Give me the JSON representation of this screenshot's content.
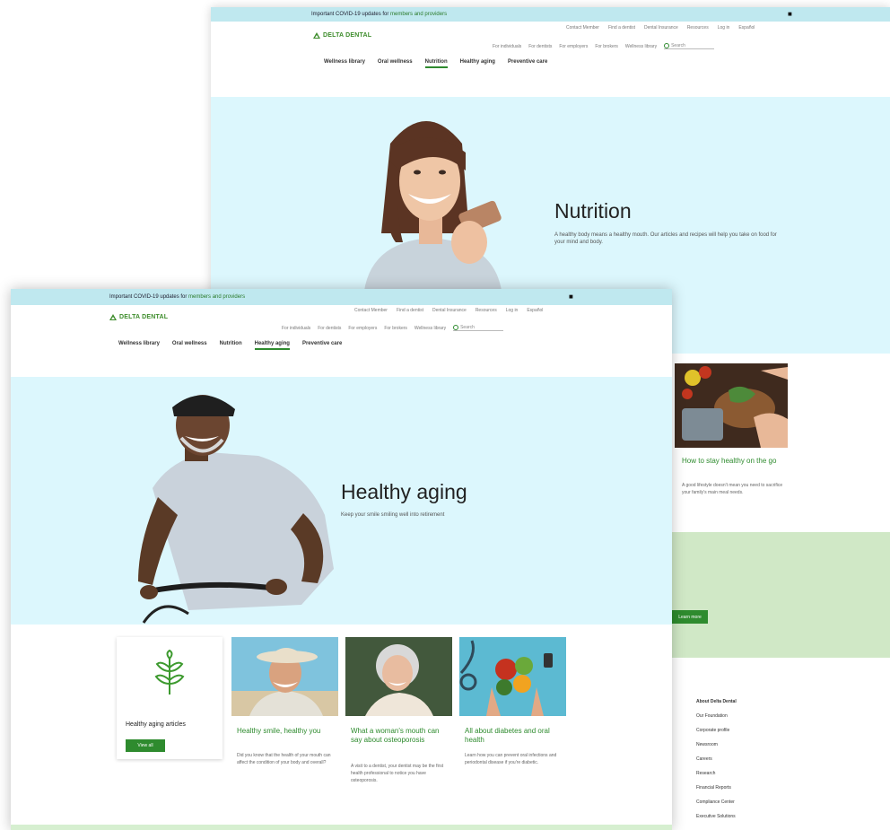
{
  "back": {
    "alert": {
      "text": "Important COVID-19 updates for ",
      "link": "members and providers"
    },
    "logo": "DELTA DENTAL",
    "util_nav": [
      "Contact Member",
      "Find a dentist",
      "Dental Insurance",
      "Resources",
      "Log in",
      "Español"
    ],
    "audience_nav": [
      "For individuals",
      "For dentists",
      "For employers",
      "For brokers",
      "Wellness library"
    ],
    "search_placeholder": "Search",
    "sub_nav": [
      {
        "label": "Wellness library",
        "active": false
      },
      {
        "label": "Oral wellness",
        "active": false
      },
      {
        "label": "Nutrition",
        "active": true
      },
      {
        "label": "Healthy aging",
        "active": false
      },
      {
        "label": "Preventive care",
        "active": false
      }
    ],
    "hero": {
      "title": "Nutrition",
      "desc": "A healthy body means a healthy mouth. Our articles and recipes will help you take on food for your mind and body."
    },
    "card": {
      "title": "How to stay healthy on the go",
      "desc": "A good lifestyle doesn't mean you need to sacrifice your family's main meal needs."
    },
    "button": "Learn more",
    "footer": {
      "heading": "About Delta Dental",
      "links": [
        "Our Foundation",
        "Corporate profile",
        "Newsroom",
        "Careers",
        "Research",
        "Financial Reports",
        "Compliance Center",
        "Executive Solutions"
      ]
    }
  },
  "front": {
    "alert": {
      "text": "Important COVID-19 updates for ",
      "link": "members and providers"
    },
    "logo": "DELTA DENTAL",
    "util_nav": [
      "Contact Member",
      "Find a dentist",
      "Dental Insurance",
      "Resources",
      "Log in",
      "Español"
    ],
    "audience_nav": [
      "For individuals",
      "For dentists",
      "For employers",
      "For brokers",
      "Wellness library"
    ],
    "search_placeholder": "Search",
    "sub_nav": [
      {
        "label": "Wellness library",
        "active": false
      },
      {
        "label": "Oral wellness",
        "active": false
      },
      {
        "label": "Nutrition",
        "active": false
      },
      {
        "label": "Healthy aging",
        "active": true
      },
      {
        "label": "Preventive care",
        "active": false
      }
    ],
    "hero": {
      "title": "Healthy aging",
      "desc": "Keep your smile smiling well into retirement"
    },
    "intro_card": {
      "title": "Healthy aging articles",
      "button": "View all"
    },
    "cards": [
      {
        "title": "Healthy smile, healthy you",
        "desc": "Did you know that the health of your mouth can affect the condition of your body and overall?"
      },
      {
        "title": "What a woman's mouth can say about osteoporosis",
        "desc": "A visit to a dentist, your dentist may be the first health professional to notice you have osteoporosis."
      },
      {
        "title": "All about diabetes and oral health",
        "desc": "Learn how you can prevent oral infections and periodontal disease if you're diabetic."
      }
    ]
  },
  "colors": {
    "accent_green": "#2e8b2e",
    "hero_bg": "#dcf7fd",
    "alert_bg": "#bfe8ef",
    "band_green": "#d0e8c6"
  },
  "icons": [
    "close-icon",
    "search-icon",
    "logo-icon",
    "plant-icon"
  ]
}
